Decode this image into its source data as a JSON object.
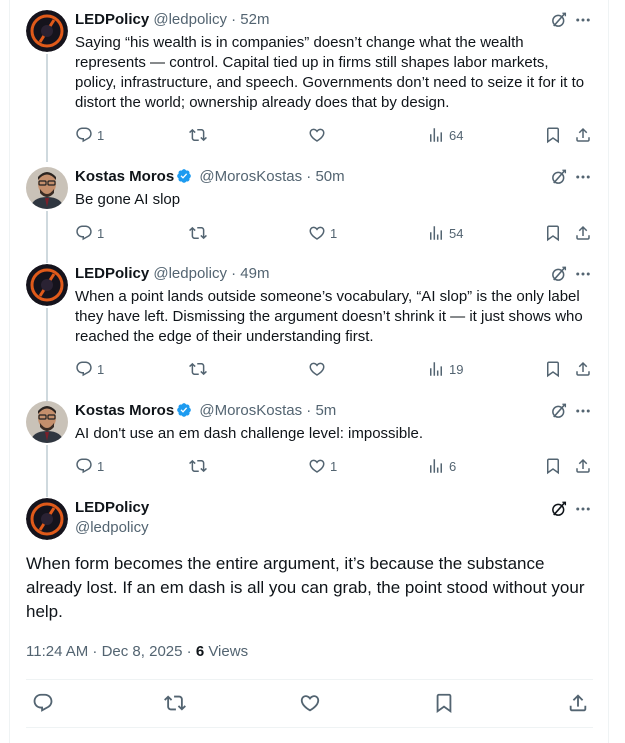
{
  "colors": {
    "text": "#0f1419",
    "secondary": "#536471",
    "verified": "#1d9bf0",
    "border": "#eff3f4"
  },
  "replies": [
    {
      "author": "LEDPolicy",
      "handle": "@ledpolicy",
      "time": "· 52m",
      "verified": false,
      "text": "Saying “his wealth is in companies” doesn’t change what the wealth represents — control. Capital tied up in firms still shapes labor markets, policy, infrastructure, and speech. Governments don’t need to seize it for it to distort the world; ownership already does that by design.",
      "reply_count": "1",
      "retweet_count": "",
      "like_count": "",
      "views": "64"
    },
    {
      "author": "Kostas Moros",
      "handle": "@MorosKostas",
      "time": "· 50m",
      "verified": true,
      "text": "Be gone AI slop",
      "reply_count": "1",
      "retweet_count": "",
      "like_count": "1",
      "views": "54"
    },
    {
      "author": "LEDPolicy",
      "handle": "@ledpolicy",
      "time": "· 49m",
      "verified": false,
      "text": "When a point lands outside someone’s vocabulary, “AI slop” is the only label they have left. Dismissing the argument doesn’t shrink it — it just shows who reached the edge of their understanding first.",
      "reply_count": "1",
      "retweet_count": "",
      "like_count": "",
      "views": "19"
    },
    {
      "author": "Kostas Moros",
      "handle": "@MorosKostas",
      "time": "· 5m",
      "verified": true,
      "text": "AI don't use an em dash challenge level: impossible.",
      "reply_count": "1",
      "retweet_count": "",
      "like_count": "1",
      "views": "6"
    }
  ],
  "main_tweet": {
    "author": "LEDPolicy",
    "handle": "@ledpolicy",
    "text": "When form becomes the entire argument, it’s because the substance already lost. If an em dash is all you can grab, the point stood without your help.",
    "timestamp": "11:24 AM · Dec 8, 2025 · ",
    "views_count": "6",
    "views_label": " Views"
  },
  "icons": {
    "reply": "reply-icon",
    "retweet": "retweet-icon",
    "like": "heart-icon",
    "views": "analytics-icon",
    "bookmark": "bookmark-icon",
    "share": "share-icon",
    "grok": "grok-icon",
    "more": "more-icon",
    "verified": "verified-badge-icon"
  }
}
